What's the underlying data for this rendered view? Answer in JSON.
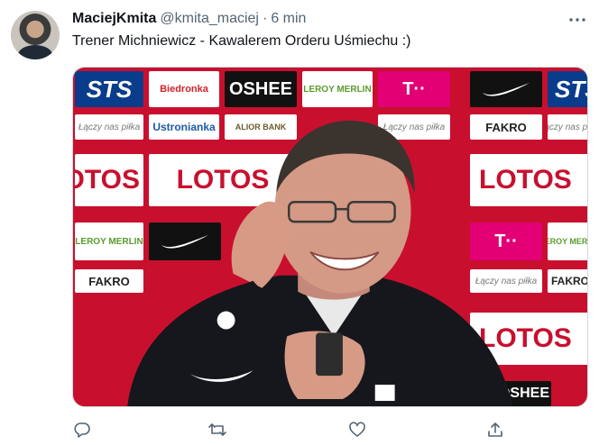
{
  "tweet": {
    "author_name": "MaciejKmita",
    "author_handle": "@kmita_maciej",
    "separator": "·",
    "time": "6 min",
    "text": "Trener Michniewicz - Kawalerem Orderu Uśmiechu :)"
  },
  "media": {
    "sponsor_board": {
      "row1": [
        "STS",
        "Biedronka",
        "OSHEE",
        "LEROY MERLIN",
        "T··",
        "",
        "STS"
      ],
      "row2": [
        "Łączy nas piłka",
        "Ustronianka",
        "ALIOR BANK",
        "Łączy nas piłka",
        "FAKRO",
        "Łączy nas piłka"
      ],
      "row3": [
        "LOTOS",
        "LOTOS",
        "LOTOS"
      ],
      "row4": [
        "LEROY MERLIN",
        "",
        "T··",
        "LEROY MERLIN"
      ],
      "row5": [
        "FAKRO",
        "Łączy nas piłka",
        "FAKRO"
      ],
      "row6": [
        "LOTOS",
        "OSHEE"
      ]
    }
  },
  "actions": [
    "reply",
    "retweet",
    "like",
    "share"
  ],
  "colors": {
    "text_primary": "#0f1419",
    "text_secondary": "#536471",
    "board_red": "#c8102e",
    "border": "#cfd9de"
  }
}
